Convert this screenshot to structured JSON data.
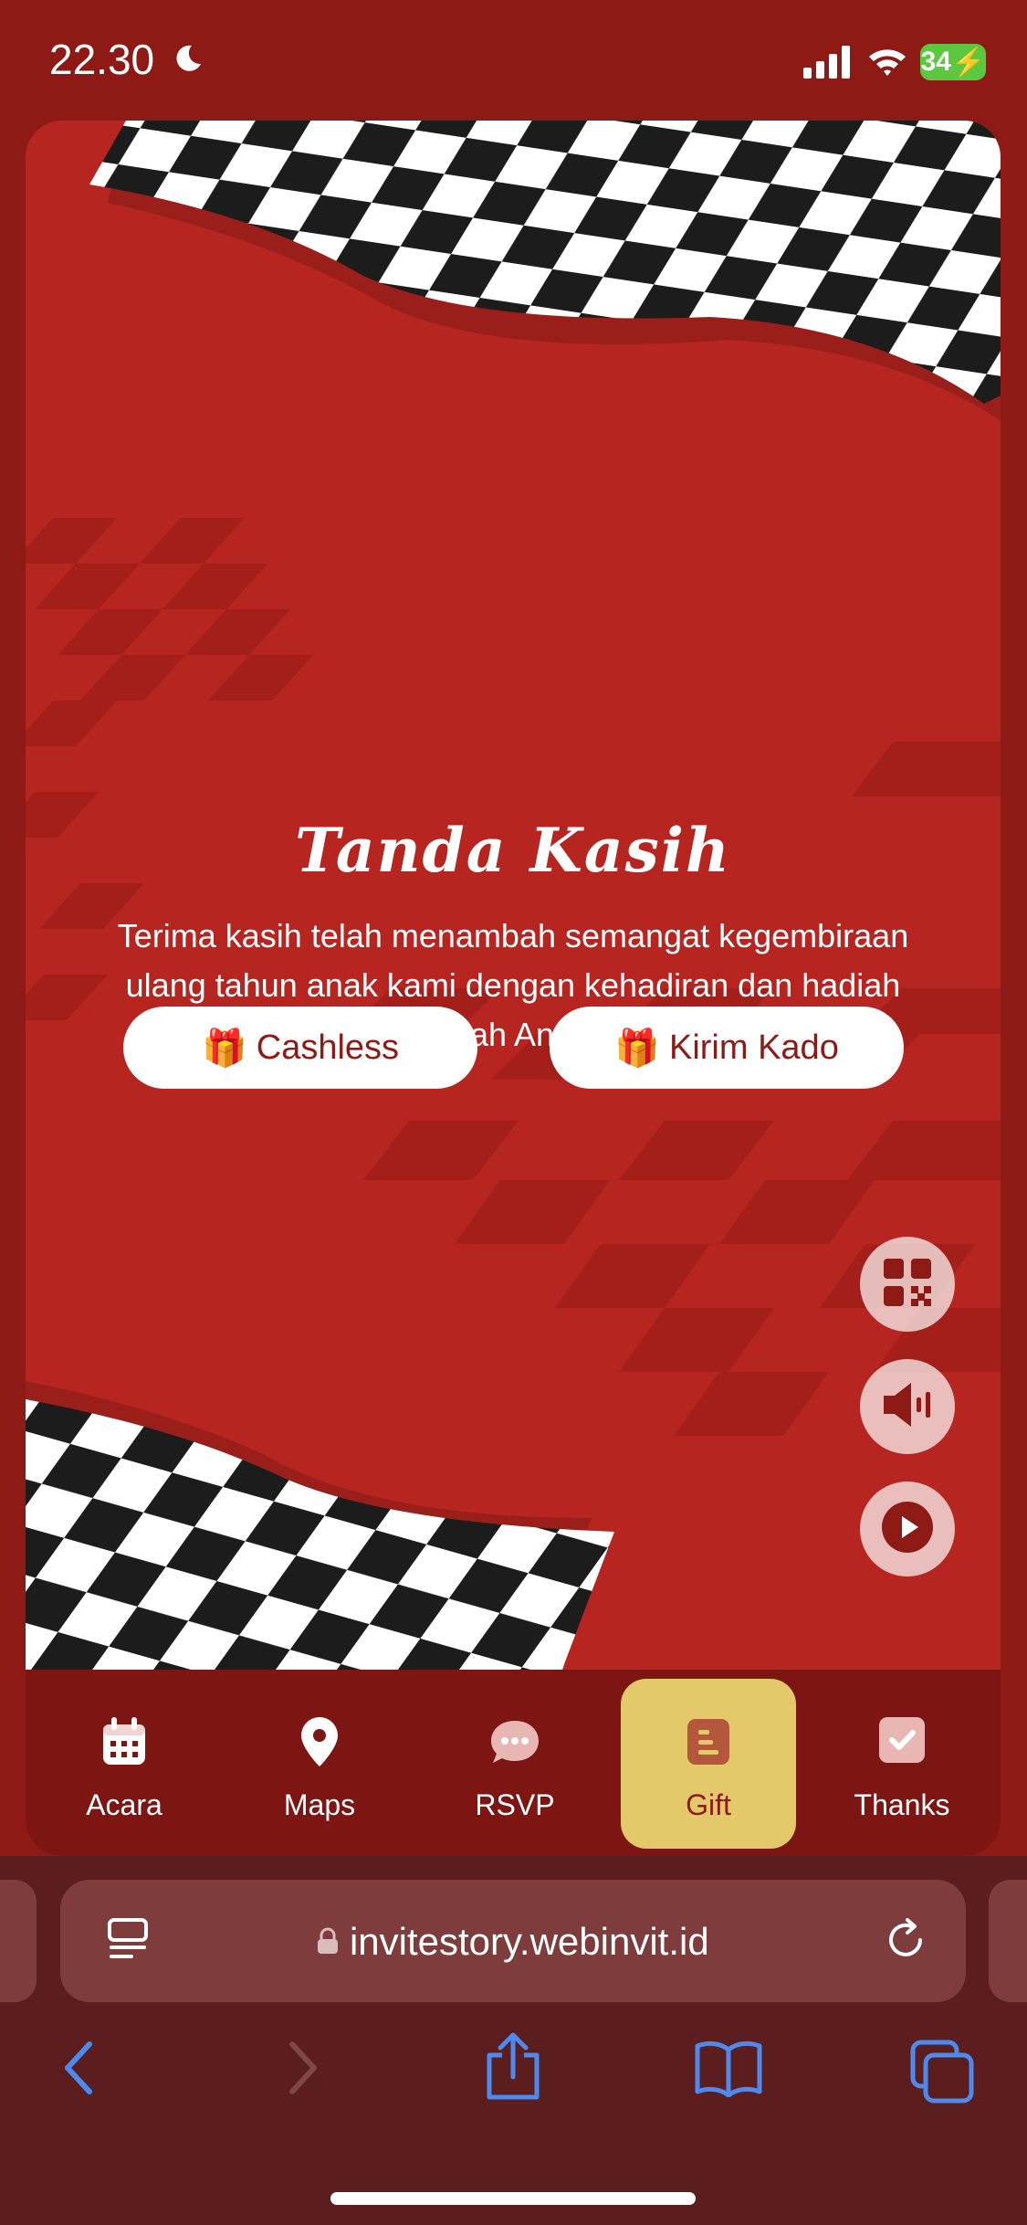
{
  "status": {
    "time": "22.30",
    "battery": "34"
  },
  "section": {
    "title": "Tanda Kasih",
    "message": "Terima kasih telah menambah semangat kegembiraan ulang tahun anak kami dengan kehadiran dan hadiah indah Anda."
  },
  "buttons": {
    "cashless": "Cashless",
    "kirim_kado": "Kirim Kado",
    "gift_emoji": "🎁"
  },
  "nav": {
    "items": [
      {
        "label": "Acara"
      },
      {
        "label": "Maps"
      },
      {
        "label": "RSVP"
      },
      {
        "label": "Gift"
      },
      {
        "label": "Thanks"
      }
    ],
    "active": "Gift"
  },
  "browser": {
    "url": "invitestory.webinvit.id"
  },
  "colors": {
    "background": "#b72520",
    "nav_active": "#e4c96a",
    "accent": "#8e1a16"
  }
}
